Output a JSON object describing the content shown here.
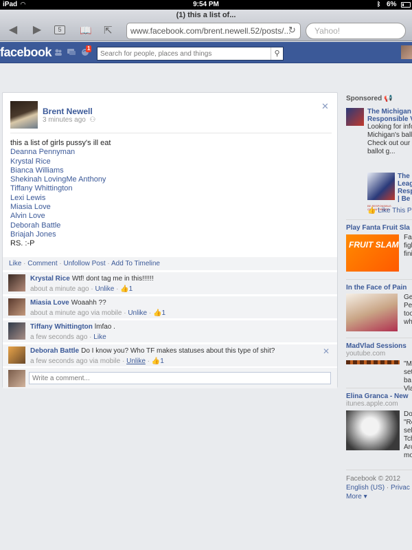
{
  "status_bar": {
    "carrier": "iPad",
    "time": "9:54 PM",
    "battery": "6%"
  },
  "safari": {
    "page_title": "(1) this a list of...",
    "tab_count": "5",
    "url": "www.facebook.com/brent.newell.52/posts/...",
    "search_placeholder": "Yahoo!"
  },
  "fb": {
    "logo": "facebook",
    "notification_count": "1",
    "search_placeholder": "Search for people, places and things"
  },
  "post": {
    "author": "Brent Newell",
    "time": "3 minutes ago",
    "text": "this a list of girls pussy's ill eat",
    "tags": [
      "Deanna Pennyman",
      "Krystal Rice",
      "Bianca Williams",
      "Shekinah LovingMe Anthony",
      "Tiffany Whittington",
      "Lexi Lewis",
      "Miasia Love",
      "Alvin Love",
      "Deborah Battle",
      "Briajah Jones"
    ],
    "signoff": "RS. :-P",
    "actions": {
      "like": "Like",
      "comment": "Comment",
      "unfollow": "Unfollow Post",
      "timeline": "Add To Timeline"
    }
  },
  "comments": [
    {
      "name": "Krystal Rice",
      "text": "Wtf! dont tag me in this!!!!!!",
      "time": "about a minute ago",
      "via": "",
      "action": "Unlike",
      "likes": "1"
    },
    {
      "name": "Miasia Love",
      "text": "Woaahh ??",
      "time": "about a minute ago",
      "via": "via mobile",
      "action": "Unlike",
      "likes": "1"
    },
    {
      "name": "Tiffany Whittington",
      "text": "lmfao .",
      "time": "a few seconds ago",
      "via": "",
      "action": "Like",
      "likes": ""
    },
    {
      "name": "Deborah Battle",
      "text": "Do I know you? Who TF makes statuses about this type of shit?",
      "time": "a few seconds ago",
      "via": "via mobile",
      "action": "Unlike",
      "likes": "1"
    }
  ],
  "write_comment_placeholder": "Write a comment...",
  "sidebar": {
    "sponsored_label": "Sponsored",
    "ad1": {
      "title1": "The Michigan",
      "title2": "Responsible V",
      "text": [
        "Looking for info",
        "Michigan's ballo",
        "Check out our",
        "ballot g..."
      ]
    },
    "ad1b": {
      "title": [
        "The",
        "Leag",
        "Resp",
        "| Be"
      ],
      "img_caption": "BE RESPONSIBLE. GET INFORMED.",
      "like": "Like This Pa"
    },
    "ad2": {
      "title": "Play Fanta Fruit Sla",
      "img_text": "FRUIT SLAM",
      "text": [
        "Fan",
        "figh",
        "fini"
      ]
    },
    "ad3": {
      "title": "In the Face of Pain",
      "text": [
        "Ge",
        "Pe",
        "too",
        "wh"
      ]
    },
    "ad4": {
      "title": "MadVlad Sessions",
      "sub": "youtube.com",
      "text": [
        "\"M",
        "set",
        "ba",
        "Vla"
      ]
    },
    "ad5": {
      "title": "Elina Granca - New",
      "sub": "itunes.apple.com",
      "text": [
        "Do",
        "\"Ro",
        "sel",
        "Tch",
        "Arc",
        "mo"
      ]
    },
    "footer": {
      "copyright": "Facebook © 2012",
      "lang": "English (US)",
      "privacy": "Privac",
      "more": "More"
    }
  },
  "colors": {
    "fb_blue": "#3b5998",
    "page_bg": "#e9ebee",
    "link": "#3b5998"
  }
}
